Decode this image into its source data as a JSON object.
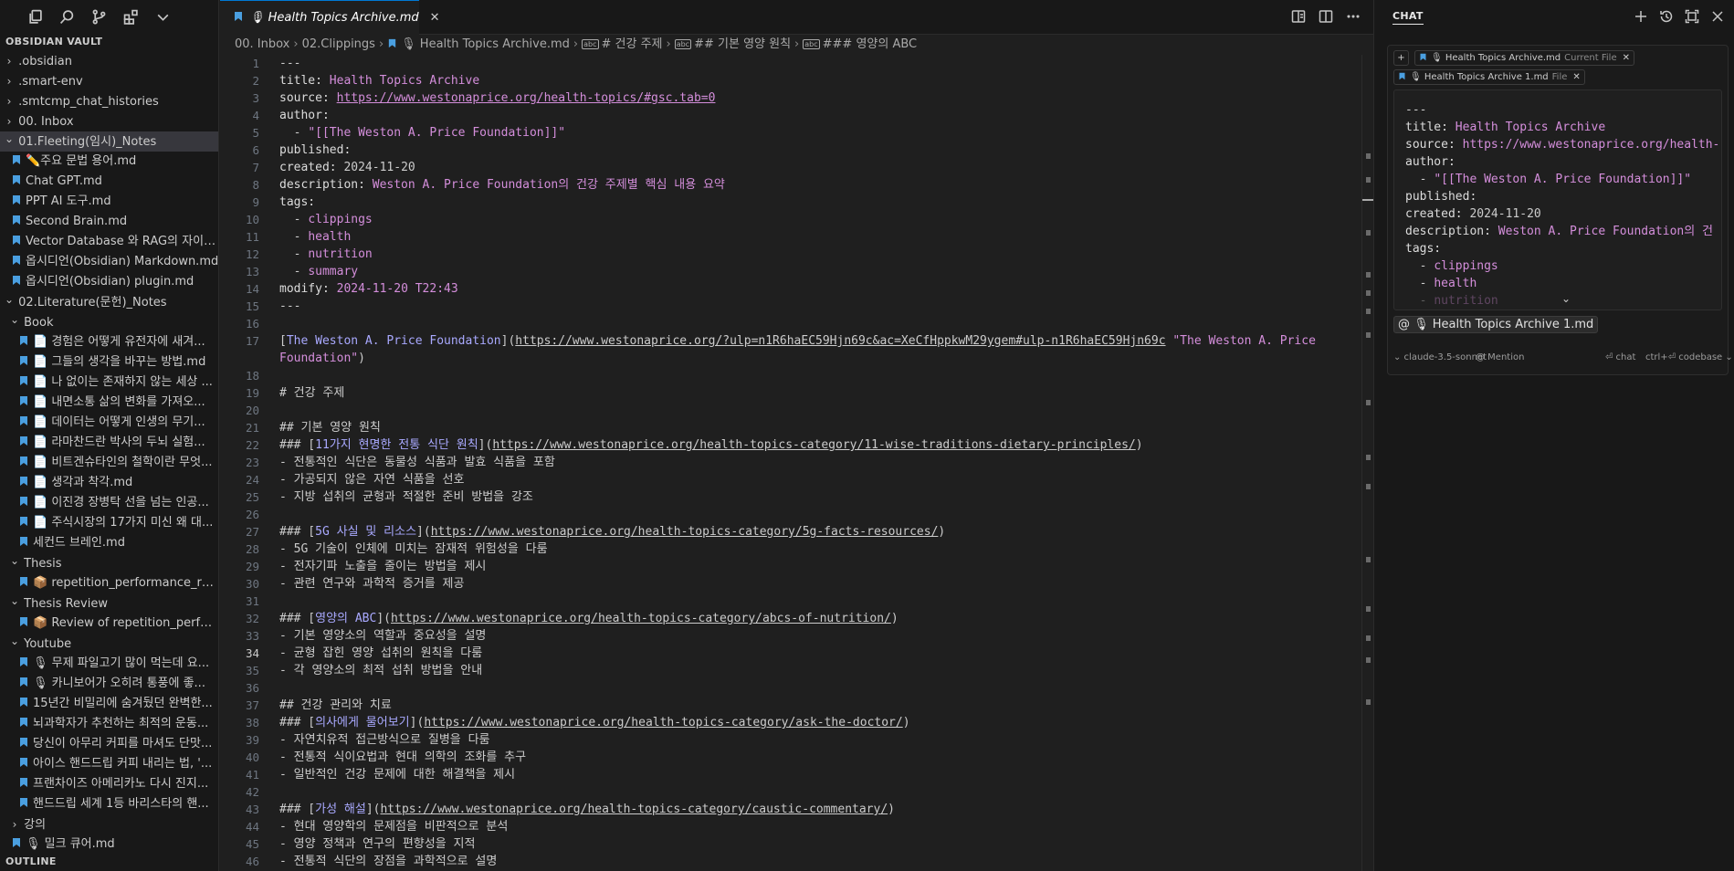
{
  "sidebar": {
    "section_title": "OBSIDIAN VAULT",
    "outline_title": "OUTLINE",
    "icons": [
      "explorer-icon",
      "search-icon",
      "source-control-icon",
      "extensions-icon",
      "chevron-down-icon"
    ],
    "items": [
      {
        "label": ".obsidian",
        "type": "folder",
        "depth": 0,
        "expanded": false
      },
      {
        "label": ".smart-env",
        "type": "folder",
        "depth": 0,
        "expanded": false
      },
      {
        "label": ".smtcmp_chat_histories",
        "type": "folder",
        "depth": 0,
        "expanded": false
      },
      {
        "label": "00. Inbox",
        "type": "folder",
        "depth": 0,
        "expanded": false
      },
      {
        "label": "01.Fleeting(임시)_Notes",
        "type": "folder",
        "depth": 0,
        "expanded": true,
        "active": true
      },
      {
        "label": "✏️주요 문법 용어.md",
        "type": "file",
        "depth": 1
      },
      {
        "label": "Chat GPT.md",
        "type": "file",
        "depth": 1
      },
      {
        "label": "PPT AI 도구.md",
        "type": "file",
        "depth": 1
      },
      {
        "label": "Second Brain.md",
        "type": "file",
        "depth": 1
      },
      {
        "label": "Vector Database 와 RAG의 자이점....",
        "type": "file",
        "depth": 1
      },
      {
        "label": "옵시디언(Obsidian) Markdown.md",
        "type": "file",
        "depth": 1
      },
      {
        "label": "옵시디언(Obsidian) plugin.md",
        "type": "file",
        "depth": 1
      },
      {
        "label": "02.Literature(문헌)_Notes",
        "type": "folder",
        "depth": 0,
        "expanded": true
      },
      {
        "label": "Book",
        "type": "folder",
        "depth": 1,
        "expanded": true
      },
      {
        "label": "📄 경험은 어떻게 유전자에 새겨...",
        "type": "file",
        "depth": 2
      },
      {
        "label": "📄 그들의 생각을 바꾸는 방법.md",
        "type": "file",
        "depth": 2
      },
      {
        "label": "📄 나 없이는 존재하지 않는 세상 ...",
        "type": "file",
        "depth": 2
      },
      {
        "label": "📄 내면소통 삶의 변화를 가져오...",
        "type": "file",
        "depth": 2
      },
      {
        "label": "📄 데이터는 어떻게 인생의 무기...",
        "type": "file",
        "depth": 2
      },
      {
        "label": "📄 라마찬드란 박사의 두뇌 실험...",
        "type": "file",
        "depth": 2
      },
      {
        "label": "📄 비트겐슈타인의 철학이란 무엇...",
        "type": "file",
        "depth": 2
      },
      {
        "label": "📄 생각과 착각.md",
        "type": "file",
        "depth": 2
      },
      {
        "label": "📄 이진경 장병탁 선을 넘는 인공...",
        "type": "file",
        "depth": 2
      },
      {
        "label": "📄 주식시장의 17가지 미신 왜 대...",
        "type": "file",
        "depth": 2
      },
      {
        "label": "세컨드 브레인.md",
        "type": "file",
        "depth": 2
      },
      {
        "label": "Thesis",
        "type": "folder",
        "depth": 1,
        "expanded": true
      },
      {
        "label": "📦 repetition_performance_rating...",
        "type": "file",
        "depth": 2
      },
      {
        "label": "Thesis Review",
        "type": "folder",
        "depth": 1,
        "expanded": true
      },
      {
        "label": "📦 Review of repetition_performa...",
        "type": "file",
        "depth": 2
      },
      {
        "label": "Youtube",
        "type": "folder",
        "depth": 1,
        "expanded": true
      },
      {
        "label": "🎙 무제 파일고기 많이 먹는데 요...",
        "type": "file",
        "depth": 2
      },
      {
        "label": "🎙 카니보어가 오히려 통풍에 좋...",
        "type": "file",
        "depth": 2
      },
      {
        "label": "15년간 비밀리에 숨겨뒀던 완벽한...",
        "type": "file",
        "depth": 2
      },
      {
        "label": "뇌과학자가 추천하는 최적의 운동...",
        "type": "file",
        "depth": 2
      },
      {
        "label": "당신이 아무리 커피를 마셔도 단맛...",
        "type": "file",
        "depth": 2
      },
      {
        "label": "아이스 핸드드립 커피 내리는 법, '...",
        "type": "file",
        "depth": 2
      },
      {
        "label": "프랜차이즈 아메리카노 다시 진지...",
        "type": "file",
        "depth": 2
      },
      {
        "label": "핸드드립 세계 1등 바리스타의 핸...",
        "type": "file",
        "depth": 2
      },
      {
        "label": "강의",
        "type": "folder",
        "depth": 1,
        "expanded": false
      },
      {
        "label": "🎙 밀크 큐어.md",
        "type": "file",
        "depth": 1
      }
    ]
  },
  "editor": {
    "tab_label": "🎙 Health Topics Archive.md",
    "breadcrumb": [
      "00. Inbox",
      "02.Clippings",
      "🎙 Health Topics Archive.md",
      "# 건강 주제",
      "## 기본 영양 원칙",
      "### 영양의 ABC"
    ],
    "current_line": 34,
    "lines": [
      {
        "n": 1,
        "parts": [
          {
            "t": "---",
            "c": "tx"
          }
        ]
      },
      {
        "n": 2,
        "parts": [
          {
            "t": "title: ",
            "c": "k"
          },
          {
            "t": "Health Topics Archive",
            "c": "v"
          }
        ]
      },
      {
        "n": 3,
        "parts": [
          {
            "t": "source: ",
            "c": "k"
          },
          {
            "t": "https://www.westonaprice.org/health-topics/#gsc.tab=0",
            "c": "u"
          }
        ]
      },
      {
        "n": 4,
        "parts": [
          {
            "t": "author:",
            "c": "k"
          }
        ]
      },
      {
        "n": 5,
        "parts": [
          {
            "t": "  - ",
            "c": "tx"
          },
          {
            "t": "\"[[The Weston A. Price Foundation]]\"",
            "c": "v"
          }
        ]
      },
      {
        "n": 6,
        "parts": [
          {
            "t": "published:",
            "c": "k"
          }
        ]
      },
      {
        "n": 7,
        "parts": [
          {
            "t": "created: ",
            "c": "k"
          },
          {
            "t": "2024-11-20",
            "c": "tx"
          }
        ]
      },
      {
        "n": 8,
        "parts": [
          {
            "t": "description: ",
            "c": "k"
          },
          {
            "t": "Weston A. Price Foundation의 건강 주제별 핵심 내용 요약",
            "c": "v"
          }
        ]
      },
      {
        "n": 9,
        "parts": [
          {
            "t": "tags:",
            "c": "k"
          }
        ]
      },
      {
        "n": 10,
        "parts": [
          {
            "t": "  - ",
            "c": "tx"
          },
          {
            "t": "clippings",
            "c": "v"
          }
        ]
      },
      {
        "n": 11,
        "parts": [
          {
            "t": "  - ",
            "c": "tx"
          },
          {
            "t": "health",
            "c": "v"
          }
        ]
      },
      {
        "n": 12,
        "parts": [
          {
            "t": "  - ",
            "c": "tx"
          },
          {
            "t": "nutrition",
            "c": "v"
          }
        ]
      },
      {
        "n": 13,
        "parts": [
          {
            "t": "  - ",
            "c": "tx"
          },
          {
            "t": "summary",
            "c": "v"
          }
        ]
      },
      {
        "n": 14,
        "parts": [
          {
            "t": "modify: ",
            "c": "k"
          },
          {
            "t": "2024-11-20 T22:43",
            "c": "v"
          }
        ]
      },
      {
        "n": 15,
        "parts": [
          {
            "t": "---",
            "c": "tx"
          }
        ]
      },
      {
        "n": 16,
        "parts": []
      },
      {
        "n": 17,
        "parts": [
          {
            "t": "[",
            "c": "tx"
          },
          {
            "t": "The Weston A. Price Foundation",
            "c": "lt"
          },
          {
            "t": "](",
            "c": "tx"
          },
          {
            "t": "https://www.westonaprice.org/?ulp=n1R6haEC59Hjn69c&ac=XeCfHppkwM29ygem#ulp-n1R6haEC59Hjn69c",
            "c": "ur"
          },
          {
            "t": " \"The Weston A. Price Foundation\"",
            "c": "v"
          },
          {
            "t": ")",
            "c": "tx"
          }
        ]
      },
      {
        "n": 18,
        "parts": []
      },
      {
        "n": 19,
        "parts": [
          {
            "t": "# 건강 주제",
            "c": "tx"
          }
        ]
      },
      {
        "n": 20,
        "parts": []
      },
      {
        "n": 21,
        "parts": [
          {
            "t": "## 기본 영양 원칙",
            "c": "tx"
          }
        ]
      },
      {
        "n": 22,
        "parts": [
          {
            "t": "### [",
            "c": "tx"
          },
          {
            "t": "11가지 현명한 전통 식단 원칙",
            "c": "lt"
          },
          {
            "t": "](",
            "c": "tx"
          },
          {
            "t": "https://www.westonaprice.org/health-topics-category/11-wise-traditions-dietary-principles/",
            "c": "ur"
          },
          {
            "t": ")",
            "c": "tx"
          }
        ]
      },
      {
        "n": 23,
        "parts": [
          {
            "t": "- 전통적인 식단은 동물성 식품과 발효 식품을 포함",
            "c": "tx"
          }
        ]
      },
      {
        "n": 24,
        "parts": [
          {
            "t": "- 가공되지 않은 자연 식품을 선호",
            "c": "tx"
          }
        ]
      },
      {
        "n": 25,
        "parts": [
          {
            "t": "- 지방 섭취의 균형과 적절한 준비 방법을 강조",
            "c": "tx"
          }
        ]
      },
      {
        "n": 26,
        "parts": []
      },
      {
        "n": 27,
        "parts": [
          {
            "t": "### [",
            "c": "tx"
          },
          {
            "t": "5G 사실 및 리소스",
            "c": "lt"
          },
          {
            "t": "](",
            "c": "tx"
          },
          {
            "t": "https://www.westonaprice.org/health-topics-category/5g-facts-resources/",
            "c": "ur"
          },
          {
            "t": ")",
            "c": "tx"
          }
        ]
      },
      {
        "n": 28,
        "parts": [
          {
            "t": "- 5G 기술이 인체에 미치는 잠재적 위험성을 다룸",
            "c": "tx"
          }
        ]
      },
      {
        "n": 29,
        "parts": [
          {
            "t": "- 전자기파 노출을 줄이는 방법을 제시",
            "c": "tx"
          }
        ]
      },
      {
        "n": 30,
        "parts": [
          {
            "t": "- 관련 연구와 과학적 증거를 제공",
            "c": "tx"
          }
        ]
      },
      {
        "n": 31,
        "parts": []
      },
      {
        "n": 32,
        "parts": [
          {
            "t": "### [",
            "c": "tx"
          },
          {
            "t": "영양의 ABC",
            "c": "lt"
          },
          {
            "t": "](",
            "c": "tx"
          },
          {
            "t": "https://www.westonaprice.org/health-topics-category/abcs-of-nutrition/",
            "c": "ur"
          },
          {
            "t": ")",
            "c": "tx"
          }
        ]
      },
      {
        "n": 33,
        "parts": [
          {
            "t": "- 기본 영양소의 역할과 중요성을 설명",
            "c": "tx"
          }
        ]
      },
      {
        "n": 34,
        "parts": [
          {
            "t": "- 균형 잡힌 영양 섭취의 원칙을 다룸",
            "c": "tx"
          }
        ]
      },
      {
        "n": 35,
        "parts": [
          {
            "t": "- 각 영양소의 최적 섭취 방법을 안내",
            "c": "tx"
          }
        ]
      },
      {
        "n": 36,
        "parts": []
      },
      {
        "n": 37,
        "parts": [
          {
            "t": "## 건강 관리와 치료",
            "c": "tx"
          }
        ]
      },
      {
        "n": 38,
        "parts": [
          {
            "t": "### [",
            "c": "tx"
          },
          {
            "t": "의사에게 물어보기",
            "c": "lt"
          },
          {
            "t": "](",
            "c": "tx"
          },
          {
            "t": "https://www.westonaprice.org/health-topics-category/ask-the-doctor/",
            "c": "ur"
          },
          {
            "t": ")",
            "c": "tx"
          }
        ]
      },
      {
        "n": 39,
        "parts": [
          {
            "t": "- 자연치유적 접근방식으로 질병을 다룸",
            "c": "tx"
          }
        ]
      },
      {
        "n": 40,
        "parts": [
          {
            "t": "- 전통적 식이요법과 현대 의학의 조화를 추구",
            "c": "tx"
          }
        ]
      },
      {
        "n": 41,
        "parts": [
          {
            "t": "- 일반적인 건강 문제에 대한 해결책을 제시",
            "c": "tx"
          }
        ]
      },
      {
        "n": 42,
        "parts": []
      },
      {
        "n": 43,
        "parts": [
          {
            "t": "### [",
            "c": "tx"
          },
          {
            "t": "가성 해설",
            "c": "lt"
          },
          {
            "t": "](",
            "c": "tx"
          },
          {
            "t": "https://www.westonaprice.org/health-topics-category/caustic-commentary/",
            "c": "ur"
          },
          {
            "t": ")",
            "c": "tx"
          }
        ]
      },
      {
        "n": 44,
        "parts": [
          {
            "t": "- 현대 영양학의 문제점을 비판적으로 분석",
            "c": "tx"
          }
        ]
      },
      {
        "n": 45,
        "parts": [
          {
            "t": "- 영양 정책과 연구의 편향성을 지적",
            "c": "tx"
          }
        ]
      },
      {
        "n": 46,
        "parts": [
          {
            "t": "- 전통적 식단의 장점을 과학적으로 설명",
            "c": "tx"
          }
        ]
      }
    ]
  },
  "chat": {
    "title": "CHAT",
    "chips": [
      {
        "label": "🎙 Health Topics Archive.md",
        "sub": "Current File"
      },
      {
        "label": "🎙 Health Topics Archive 1.md",
        "sub": "File"
      }
    ],
    "preview_lines": [
      [
        {
          "t": "---",
          "c": "tx"
        }
      ],
      [
        {
          "t": "title: ",
          "c": "k"
        },
        {
          "t": "Health Topics Archive",
          "c": "v"
        }
      ],
      [
        {
          "t": "source: ",
          "c": "k"
        },
        {
          "t": "https://www.westonaprice.org/health-",
          "c": "v"
        }
      ],
      [
        {
          "t": "author:",
          "c": "k"
        }
      ],
      [
        {
          "t": "  - ",
          "c": "tx"
        },
        {
          "t": "\"[[The Weston A. Price Foundation]]\"",
          "c": "v"
        }
      ],
      [
        {
          "t": "published:",
          "c": "k"
        }
      ],
      [
        {
          "t": "created: ",
          "c": "k"
        },
        {
          "t": "2024-11-20",
          "c": "tx"
        }
      ],
      [
        {
          "t": "description: ",
          "c": "k"
        },
        {
          "t": "Weston A. Price Foundation의 건",
          "c": "v"
        }
      ],
      [
        {
          "t": "tags:",
          "c": "k"
        }
      ],
      [
        {
          "t": "  - ",
          "c": "tx"
        },
        {
          "t": "clippings",
          "c": "v"
        }
      ],
      [
        {
          "t": "  - ",
          "c": "tx"
        },
        {
          "t": "health",
          "c": "v"
        }
      ],
      [
        {
          "t": "  - ",
          "c": "tx"
        },
        {
          "t": "nutrition",
          "c": "v"
        }
      ]
    ],
    "mention": "@ 🎙 Health Topics Archive 1.md",
    "model": "⌄ claude-3.5-sonnet",
    "mention_btn": "@ Mention",
    "chat_btn": "⏎ chat",
    "codebase_btn": "ctrl+⏎ codebase ⌄"
  }
}
